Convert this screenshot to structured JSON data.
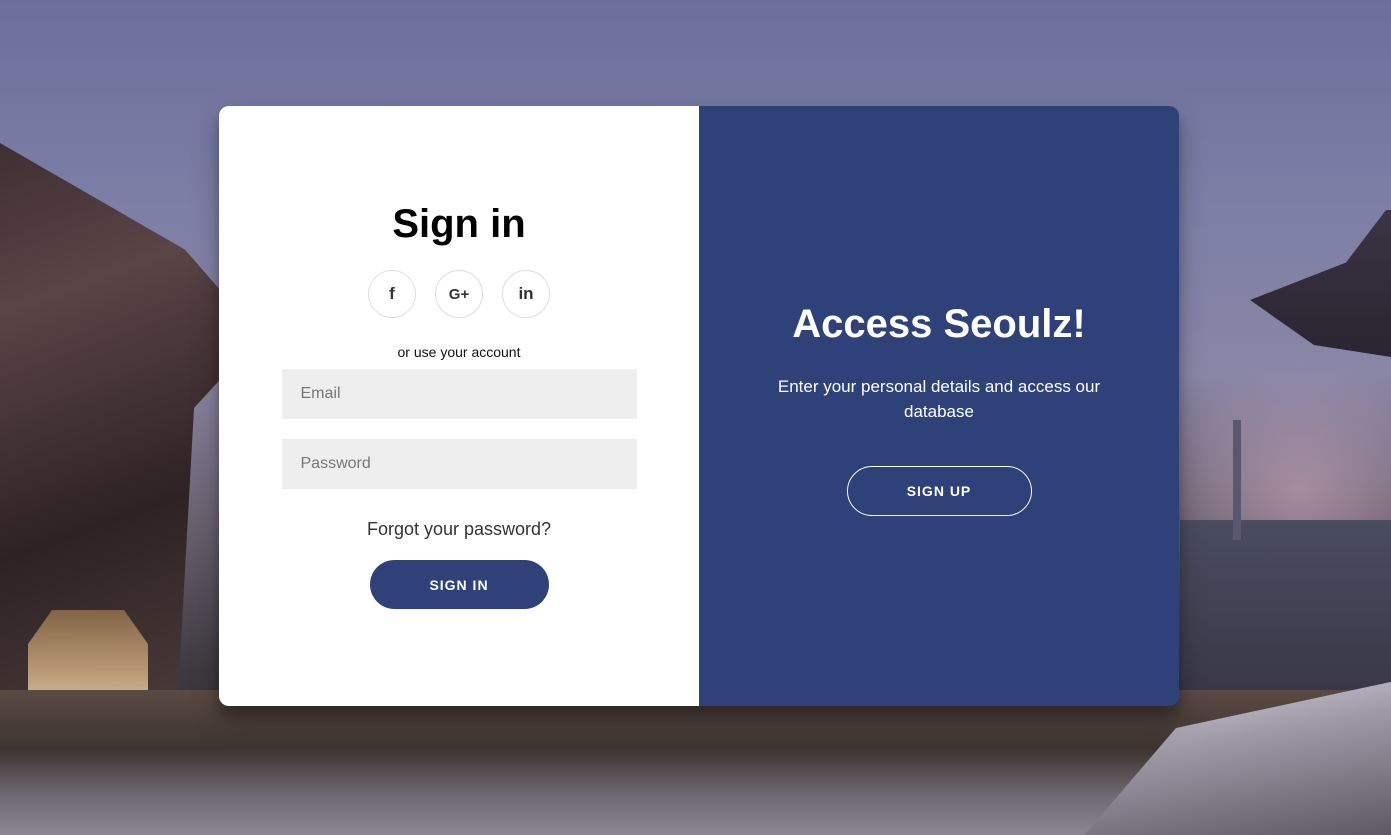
{
  "signin": {
    "title": "Sign in",
    "socials": [
      {
        "label": "f",
        "icon": "facebook-icon"
      },
      {
        "label": "G+",
        "icon": "google-plus-icon"
      },
      {
        "label": "in",
        "icon": "linkedin-icon"
      }
    ],
    "hint": "or use your account",
    "email_placeholder": "Email",
    "password_placeholder": "Password",
    "forgot": "Forgot your password?",
    "button": "SIGN IN"
  },
  "panel": {
    "title": "Access Seoulz!",
    "description": "Enter your personal details and access our database",
    "button": "SIGN UP"
  },
  "colors": {
    "primary": "#2e4178",
    "input_bg": "#eeeeee",
    "card_bg": "#ffffff"
  }
}
